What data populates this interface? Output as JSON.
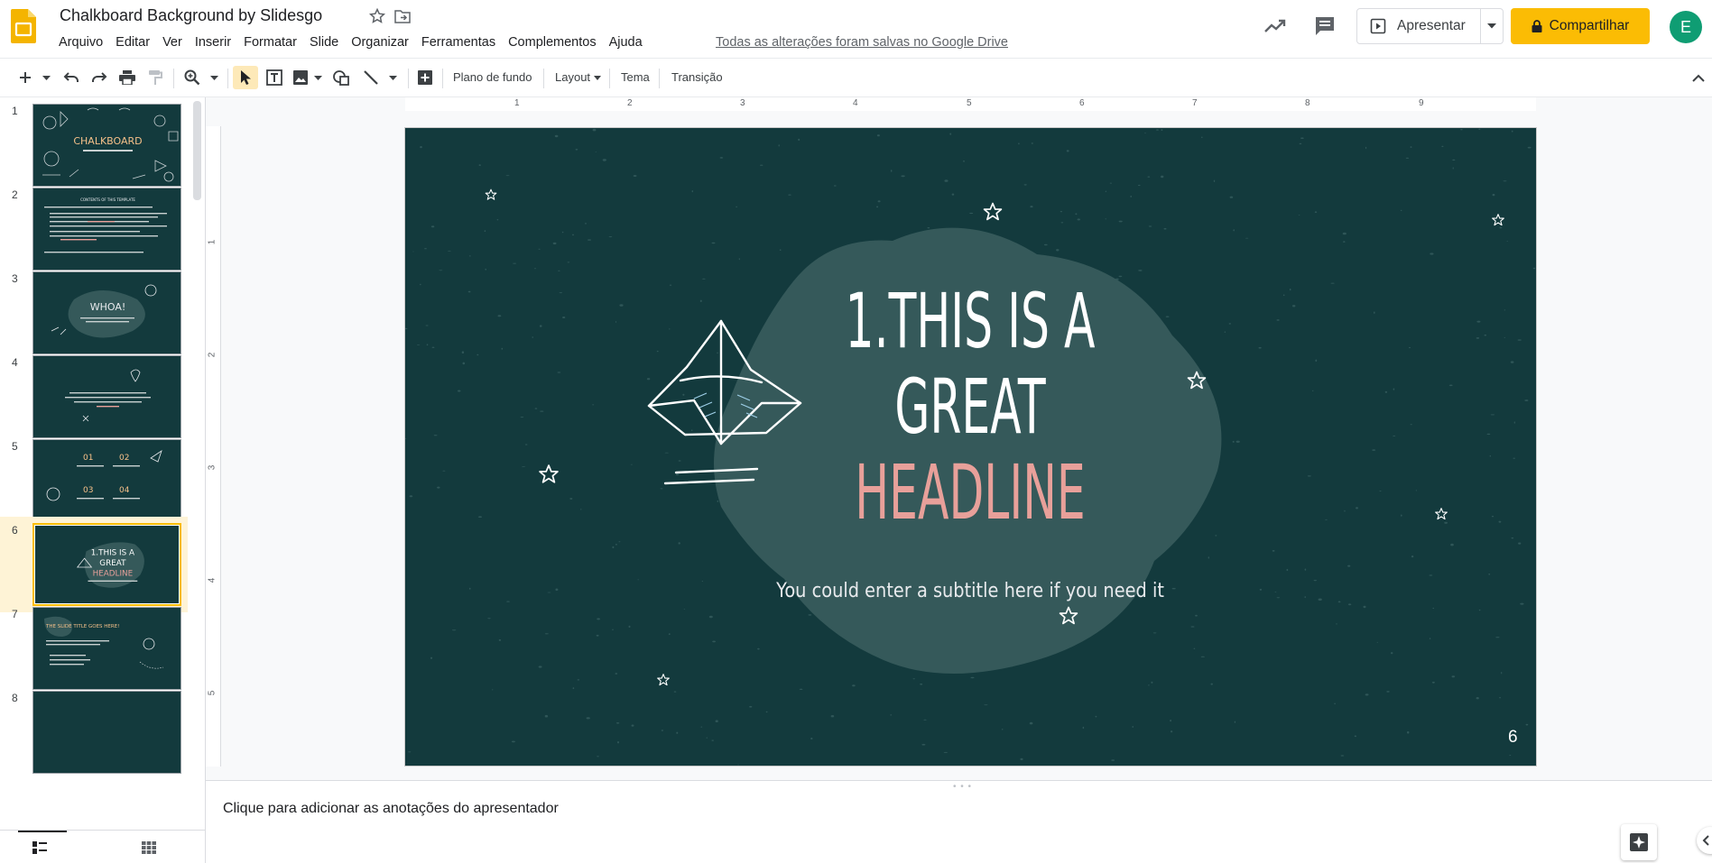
{
  "app": {
    "title": "Chalkboard Background by Slidesgo",
    "save_status": "Todas as alterações foram salvas no Google Drive",
    "accent_color": "#fbbc04",
    "avatar_letter": "E",
    "avatar_color": "#0f9d73"
  },
  "menu": {
    "items": [
      "Arquivo",
      "Editar",
      "Ver",
      "Inserir",
      "Formatar",
      "Slide",
      "Organizar",
      "Ferramentas",
      "Complementos",
      "Ajuda"
    ]
  },
  "header_actions": {
    "present_label": "Apresentar",
    "share_label": "Compartilhar"
  },
  "toolbar": {
    "background_label": "Plano de fundo",
    "layout_label": "Layout",
    "theme_label": "Tema",
    "transition_label": "Transição"
  },
  "filmstrip": {
    "selected": 6,
    "slides": [
      {
        "number": "1",
        "title": "CHALKBOARD"
      },
      {
        "number": "2",
        "title": "CONTENTS OF THIS TEMPLATE"
      },
      {
        "number": "3",
        "title": "WHOA!"
      },
      {
        "number": "4",
        "title": ""
      },
      {
        "number": "5",
        "title": ""
      },
      {
        "number": "6",
        "title": "1. THIS IS A GREAT HEADLINE"
      },
      {
        "number": "7",
        "title": "THE SLIDE TITLE GOES HERE!"
      },
      {
        "number": "8",
        "title": ""
      }
    ]
  },
  "rulers": {
    "top": [
      "1",
      "2",
      "3",
      "4",
      "5",
      "6",
      "7",
      "8",
      "9"
    ],
    "left": [
      "1",
      "2",
      "3",
      "4",
      "5"
    ]
  },
  "slide": {
    "background_color": "#133a3d",
    "blob_color": "#35595a",
    "headline_line1": "1.THIS IS A",
    "headline_line2": "GREAT",
    "headline_line3": "HEADLINE",
    "headline_accent_color": "#e8a09a",
    "subtitle": "You could enter a subtitle here if you need it",
    "number": "6"
  },
  "notes": {
    "placeholder": "Clique para adicionar as anotações do apresentador"
  }
}
